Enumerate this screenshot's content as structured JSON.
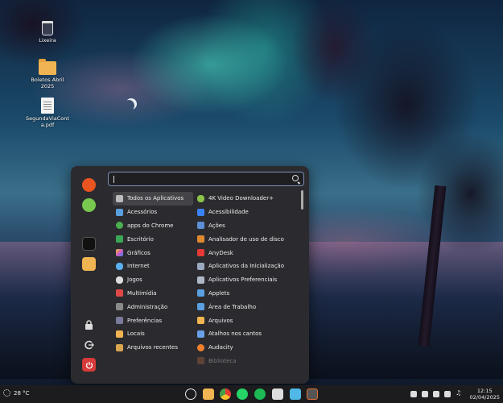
{
  "desktop": {
    "icons": [
      {
        "label": "Lixeira",
        "icon": "trash-icon"
      },
      {
        "label": "Boletos Abril 2025",
        "icon": "folder-icon"
      },
      {
        "label": "SegundaViaConta.pdf",
        "icon": "pdf-file-icon"
      }
    ]
  },
  "menu": {
    "search": {
      "placeholder": "",
      "value": ""
    },
    "favorites": [
      {
        "icon": "ubuntu-icon",
        "color": "#e95420"
      },
      {
        "icon": "green-circle-icon",
        "color": "#78c850"
      },
      {
        "icon": "terminal-icon",
        "color": "#222222"
      },
      {
        "icon": "folder-icon",
        "color": "#f0b552"
      }
    ],
    "session": [
      {
        "icon": "lock-icon"
      },
      {
        "icon": "logout-icon"
      },
      {
        "icon": "power-icon",
        "color": "#e04040"
      }
    ],
    "categories": [
      {
        "label": "Todos os Aplicativos",
        "icon": "grid-icon",
        "color": "#cccccc"
      },
      {
        "label": "Acessórios",
        "icon": "accessories-icon",
        "color": "#5aa0e0"
      },
      {
        "label": "apps do Chrome",
        "icon": "chrome-icon",
        "color": "#4caf50"
      },
      {
        "label": "Escritório",
        "icon": "office-icon",
        "color": "#3aa757"
      },
      {
        "label": "Gráficos",
        "icon": "graphics-icon",
        "color": "#d05ac0"
      },
      {
        "label": "Internet",
        "icon": "cloud-icon",
        "color": "#5ab0f0"
      },
      {
        "label": "Jogos",
        "icon": "gamepad-icon",
        "color": "#dddddd"
      },
      {
        "label": "Multimídia",
        "icon": "multimedia-icon",
        "color": "#e04848"
      },
      {
        "label": "Administração",
        "icon": "admin-icon",
        "color": "#8a8a8a"
      },
      {
        "label": "Preferências",
        "icon": "preferences-icon",
        "color": "#7a7a9a"
      },
      {
        "label": "Locais",
        "icon": "folder-icon",
        "color": "#f0b552"
      },
      {
        "label": "Arquivos recentes",
        "icon": "recent-folder-icon",
        "color": "#d9a550"
      }
    ],
    "apps": [
      {
        "label": "4K Video Downloader+",
        "icon": "cloud-download-icon",
        "color": "#8bc34a"
      },
      {
        "label": "Acessibilidade",
        "icon": "accessibility-icon",
        "color": "#3b82f6"
      },
      {
        "label": "Ações",
        "icon": "actions-icon",
        "color": "#5c8fd6"
      },
      {
        "label": "Analisador de uso de disco",
        "icon": "disk-icon",
        "color": "#e08a30"
      },
      {
        "label": "AnyDesk",
        "icon": "anydesk-icon",
        "color": "#e53935"
      },
      {
        "label": "Aplicativos da Inicialização",
        "icon": "startup-icon",
        "color": "#9aa8c0"
      },
      {
        "label": "Aplicativos Preferenciais",
        "icon": "preferred-apps-icon",
        "color": "#b0b8c8"
      },
      {
        "label": "Applets",
        "icon": "applets-icon",
        "color": "#5aa0e0"
      },
      {
        "label": "Área de Trabalho",
        "icon": "desktop-icon",
        "color": "#5aa0e0"
      },
      {
        "label": "Arquivos",
        "icon": "files-icon",
        "color": "#f0b552"
      },
      {
        "label": "Atalhos nos cantos",
        "icon": "hot-corners-icon",
        "color": "#6aa0e8"
      },
      {
        "label": "Audacity",
        "icon": "audacity-icon",
        "color": "#f08030"
      },
      {
        "label": "Biblioteca",
        "icon": "library-icon",
        "color": "#aa6644"
      }
    ]
  },
  "taskbar": {
    "weather": "28 °C",
    "time": "12:15",
    "date": "02/04/2025",
    "apps": [
      {
        "icon": "mint-menu-icon",
        "color": "#e8e8e8"
      },
      {
        "icon": "files-icon",
        "color": "#f0b552"
      },
      {
        "icon": "chrome-icon",
        "color": "#e53935"
      },
      {
        "icon": "whatsapp-icon",
        "color": "#25d366"
      },
      {
        "icon": "spotify-icon",
        "color": "#1db954"
      },
      {
        "icon": "notes-icon",
        "color": "#dddddd"
      },
      {
        "icon": "vscode-icon",
        "color": "#4fb8e6"
      },
      {
        "icon": "calculator-icon",
        "color": "#777777"
      }
    ]
  }
}
